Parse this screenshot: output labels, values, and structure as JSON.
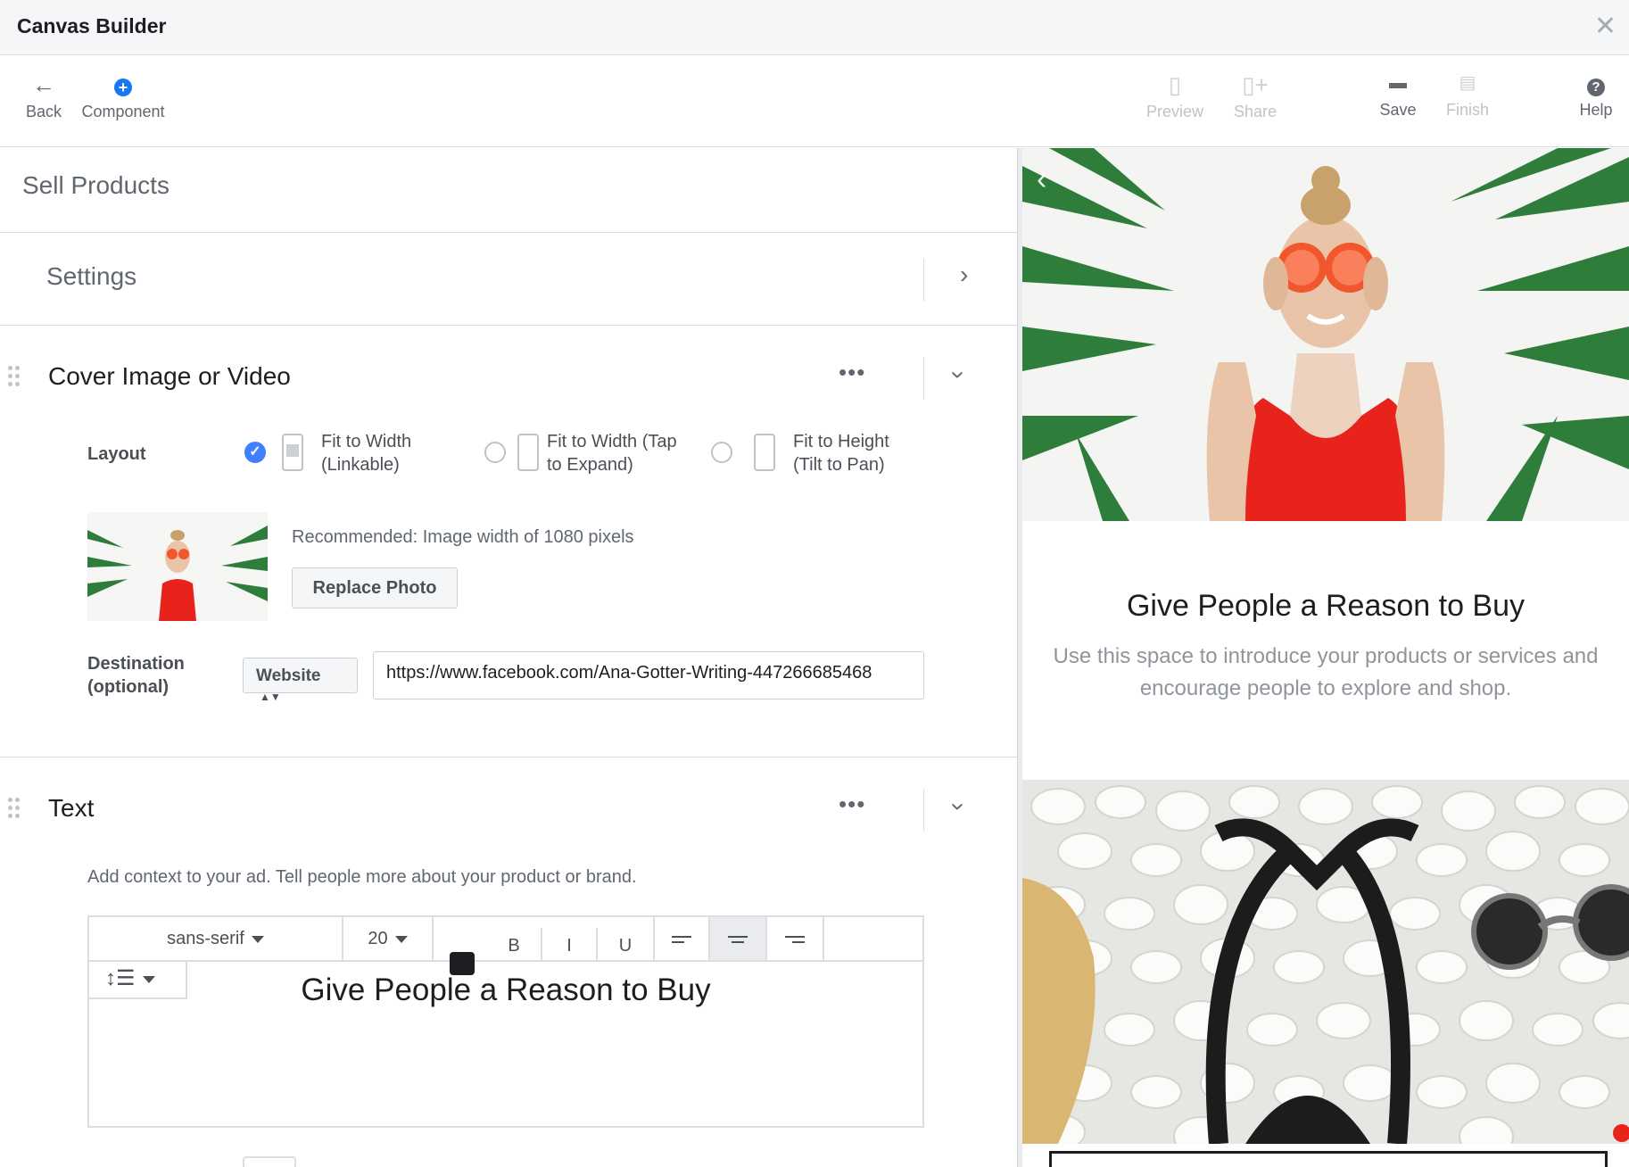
{
  "window": {
    "title": "Canvas Builder"
  },
  "toolbar": {
    "back": "Back",
    "component": "Component",
    "preview": "Preview",
    "share": "Share",
    "save": "Save",
    "finish": "Finish",
    "help": "Help"
  },
  "canvas": {
    "name": "Sell Products"
  },
  "settings": {
    "label": "Settings"
  },
  "cover": {
    "title": "Cover Image or Video",
    "layout_label": "Layout",
    "layout_options": [
      {
        "line1": "Fit to Width",
        "line2": "(Linkable)",
        "selected": true
      },
      {
        "line1": "Fit to Width (Tap",
        "line2": "to Expand)",
        "selected": false
      },
      {
        "line1": "Fit to Height",
        "line2": "(Tilt to Pan)",
        "selected": false
      }
    ],
    "recommendation": "Recommended: Image width of 1080 pixels",
    "replace_button": "Replace Photo",
    "destination_label_1": "Destination",
    "destination_label_2": "(optional)",
    "destination_type": "Website",
    "destination_url": "https://www.facebook.com/Ana-Gotter-Writing-447266685468"
  },
  "text_component": {
    "title": "Text",
    "help": "Add context to your ad. Tell people more about your product or brand.",
    "font": "sans-serif",
    "size": "20",
    "bold": "B",
    "italic": "I",
    "underline": "U",
    "content": "Give People a Reason to Buy",
    "color": "#1c1e21"
  },
  "preview": {
    "heading": "Give People a Reason to Buy",
    "body": "Use this space to introduce your products or services and encourage people to explore and shop."
  },
  "colors": {
    "accent": "#1877f2",
    "radio_selected": "#4080ff",
    "swimsuit": "#e8231c",
    "palm": "#2f7d3a"
  }
}
